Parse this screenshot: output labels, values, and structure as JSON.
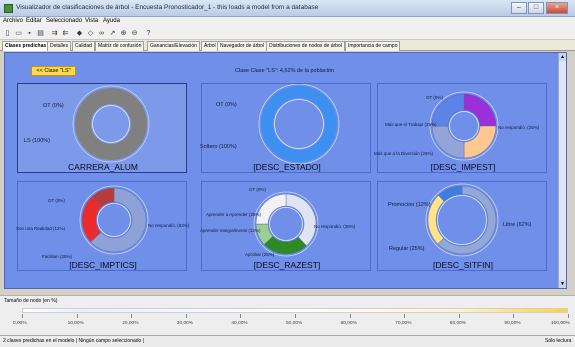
{
  "window": {
    "title": "Visualizador de clasificaciones de árbol - Encuesta Pronosticador_1 - this loads a model from a database"
  },
  "menu": [
    "Archivo",
    "Editar",
    "Seleccionado",
    "Vista",
    "Ayuda"
  ],
  "toolbar_icons": [
    "new-icon",
    "open-icon",
    "save-icon",
    "print-icon",
    "expand-icon",
    "collapse-icon",
    "forward-icon",
    "back-icon",
    "binoculars-icon",
    "pointer-icon",
    "zoom-in-icon",
    "zoom-out-icon",
    "help-icon"
  ],
  "tabs": [
    "Clases predichas",
    "Detalles",
    "Calidad",
    "Matriz de confusión",
    "Ganancias/Elevación",
    "Árbol",
    "Navegador de árbol",
    "Distribuciones de nodos de árbol",
    "Importancia de campo"
  ],
  "panel": {
    "back_button": "<< Clase \"LS\"",
    "header": "Clase Clase \"LS\": 4,62% de la población"
  },
  "charts": [
    {
      "name": "CARRERA_ALUM",
      "labels": [
        {
          "text": "OT (0%)",
          "size": "big"
        },
        {
          "text": "LS (100%)",
          "size": "big"
        }
      ],
      "slices": [
        {
          "label": "LS",
          "value": 100,
          "color": "#808080"
        }
      ]
    },
    {
      "name": "[DESC_ESTADO]",
      "labels": [
        {
          "text": "OT (0%)",
          "size": "big"
        },
        {
          "text": "Soltero (100%)",
          "size": "big"
        }
      ],
      "slices": [
        {
          "label": "Soltero",
          "value": 100,
          "color": "#3d8ff0"
        }
      ]
    },
    {
      "name": "[DESC_IMPEST]",
      "labels": [
        {
          "text": "OT (0%)",
          "size": "small"
        },
        {
          "text": "Más que el Trabajo (25%)",
          "size": "small"
        },
        {
          "text": "Más que a la Diversión (25%)",
          "size": "small"
        },
        {
          "text": "No respondió. (25%)",
          "size": "small"
        }
      ],
      "slices": [
        {
          "label": "Más que el Trabajo",
          "value": 25,
          "color": "#9b2fd8"
        },
        {
          "label": "Más que a la Diversión",
          "value": 25,
          "color": "#ffc890"
        },
        {
          "label": "No respondió.",
          "value": 25,
          "color": "#93a5d8"
        },
        {
          "label": "resto",
          "value": 25,
          "color": "#5b84e6"
        }
      ]
    },
    {
      "name": "[DESC_IMPTICS]",
      "labels": [
        {
          "text": "OT (0%)",
          "size": "small"
        },
        {
          "text": "Son una Realidad (12%)",
          "size": "small"
        },
        {
          "text": "Facilitan (25%)",
          "size": "small"
        },
        {
          "text": "No respondió. (63%)",
          "size": "small"
        }
      ],
      "slices": [
        {
          "label": "No respondió.",
          "value": 63,
          "color": "#8fa2d8"
        },
        {
          "label": "Facilitan",
          "value": 25,
          "color": "#ec2c2c"
        },
        {
          "label": "Son una Realidad",
          "value": 12,
          "color": "#b83a3a"
        }
      ]
    },
    {
      "name": "[DESC_RAZEST]",
      "labels": [
        {
          "text": "OT (0%)",
          "size": "small"
        },
        {
          "text": "Aprender a Aprender (25%)",
          "size": "small"
        },
        {
          "text": "Aprender Integralmente (12%)",
          "size": "small"
        },
        {
          "text": "Aprobar (25%)",
          "size": "small"
        },
        {
          "text": "No respondió. (38%)",
          "size": "small"
        }
      ],
      "slices": [
        {
          "label": "No respondió.",
          "value": 38,
          "color": "#dfe4f3"
        },
        {
          "label": "Aprobar",
          "value": 25,
          "color": "#2e8a22"
        },
        {
          "label": "Aprender Integralmente",
          "value": 12,
          "color": "#9ccf96"
        },
        {
          "label": "Aprender a Aprender",
          "value": 25,
          "color": "#f0f2f5"
        }
      ]
    },
    {
      "name": "[DESC_SITFIN]",
      "labels": [
        {
          "text": "Promoción (12%)",
          "size": "big"
        },
        {
          "text": "Regular (25%)",
          "size": "big"
        },
        {
          "text": "Libre (62%)",
          "size": "big"
        }
      ],
      "slices": [
        {
          "label": "Libre",
          "value": 62,
          "color": "#94a8d8"
        },
        {
          "label": "Regular",
          "value": 25,
          "color": "#ffe48a"
        },
        {
          "label": "Promoción",
          "value": 12,
          "color": "#3d7fe0"
        }
      ]
    }
  ],
  "legend": {
    "caption": "Tamaño de nodo (en %)",
    "ticks": [
      "0,00%",
      "10,00%",
      "20,00%",
      "30,00%",
      "40,00%",
      "50,00%",
      "60,00%",
      "70,00%",
      "80,00%",
      "90,00%",
      "100,00%"
    ]
  },
  "status": {
    "left": "2 clases predichas en el modelo | Ningún campo seleccionado |",
    "right": "Sólo lectura"
  }
}
